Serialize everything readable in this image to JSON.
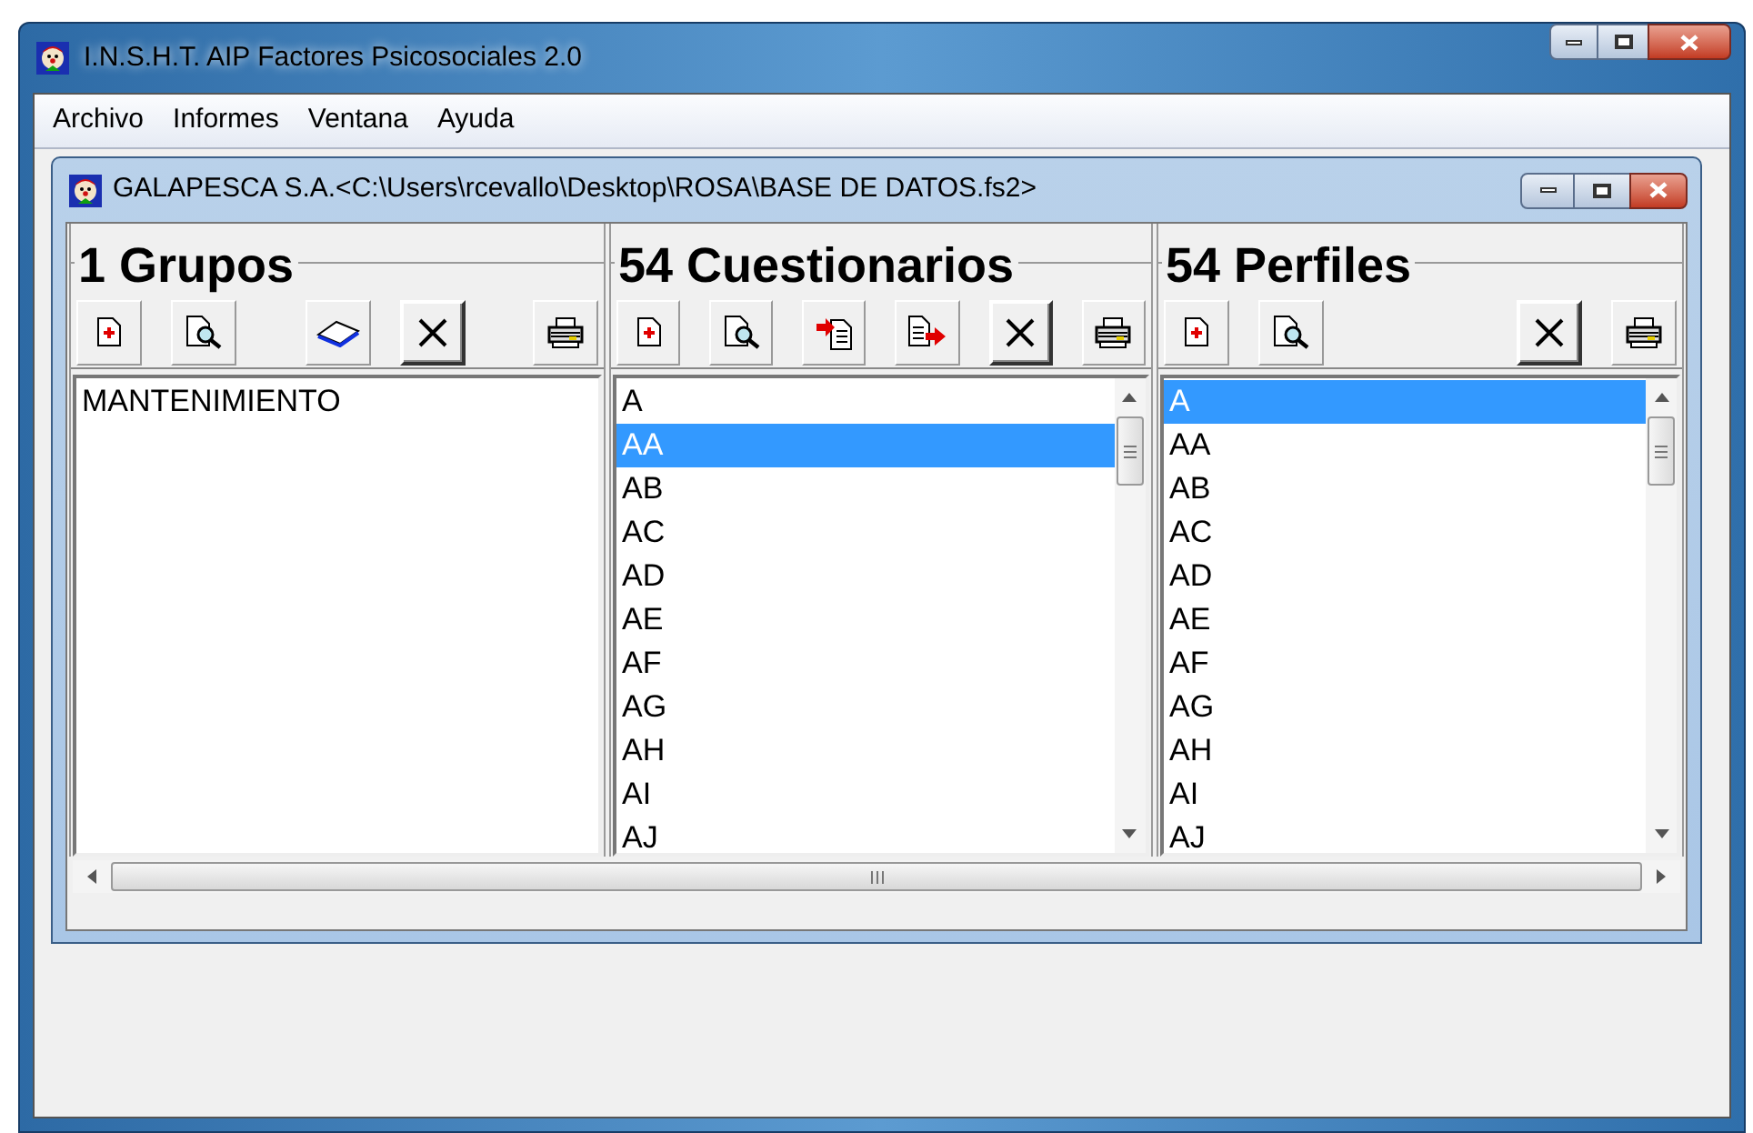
{
  "window": {
    "title": "I.N.S.H.T. AIP Factores Psicosociales 2.0"
  },
  "menu": [
    "Archivo",
    "Informes",
    "Ventana",
    "Ayuda"
  ],
  "child_window": {
    "title": "GALAPESCA S.A.<C:\\Users\\rcevallo\\Desktop\\ROSA\\BASE DE DATOS.fs2>"
  },
  "panels": [
    {
      "heading": "1 Grupos",
      "toolbar": [
        {
          "kind": "new"
        },
        {
          "kind": "preview"
        },
        {
          "kind": "gap"
        },
        {
          "kind": "book"
        },
        {
          "kind": "delete"
        },
        {
          "kind": "gap"
        },
        {
          "kind": "print"
        }
      ],
      "scrollbar": false,
      "items": [
        {
          "label": "MANTENIMIENTO",
          "selected": false
        }
      ]
    },
    {
      "heading": "54 Cuestionarios",
      "toolbar": [
        {
          "kind": "new"
        },
        {
          "kind": "preview"
        },
        {
          "kind": "import"
        },
        {
          "kind": "export"
        },
        {
          "kind": "delete"
        },
        {
          "kind": "print"
        }
      ],
      "scrollbar": true,
      "items": [
        {
          "label": "A",
          "selected": false
        },
        {
          "label": "AA",
          "selected": true
        },
        {
          "label": "AB",
          "selected": false
        },
        {
          "label": "AC",
          "selected": false
        },
        {
          "label": "AD",
          "selected": false
        },
        {
          "label": "AE",
          "selected": false
        },
        {
          "label": "AF",
          "selected": false
        },
        {
          "label": "AG",
          "selected": false
        },
        {
          "label": "AH",
          "selected": false
        },
        {
          "label": "AI",
          "selected": false
        },
        {
          "label": "AJ",
          "selected": false
        }
      ]
    },
    {
      "heading": "54 Perfiles",
      "toolbar": [
        {
          "kind": "new"
        },
        {
          "kind": "preview"
        },
        {
          "kind": "gap"
        },
        {
          "kind": "delete"
        },
        {
          "kind": "print"
        }
      ],
      "scrollbar": true,
      "items": [
        {
          "label": "A",
          "selected": true
        },
        {
          "label": "AA",
          "selected": false
        },
        {
          "label": "AB",
          "selected": false
        },
        {
          "label": "AC",
          "selected": false
        },
        {
          "label": "AD",
          "selected": false
        },
        {
          "label": "AE",
          "selected": false
        },
        {
          "label": "AF",
          "selected": false
        },
        {
          "label": "AG",
          "selected": false
        },
        {
          "label": "AH",
          "selected": false
        },
        {
          "label": "AI",
          "selected": false
        },
        {
          "label": "AJ",
          "selected": false
        }
      ]
    }
  ]
}
